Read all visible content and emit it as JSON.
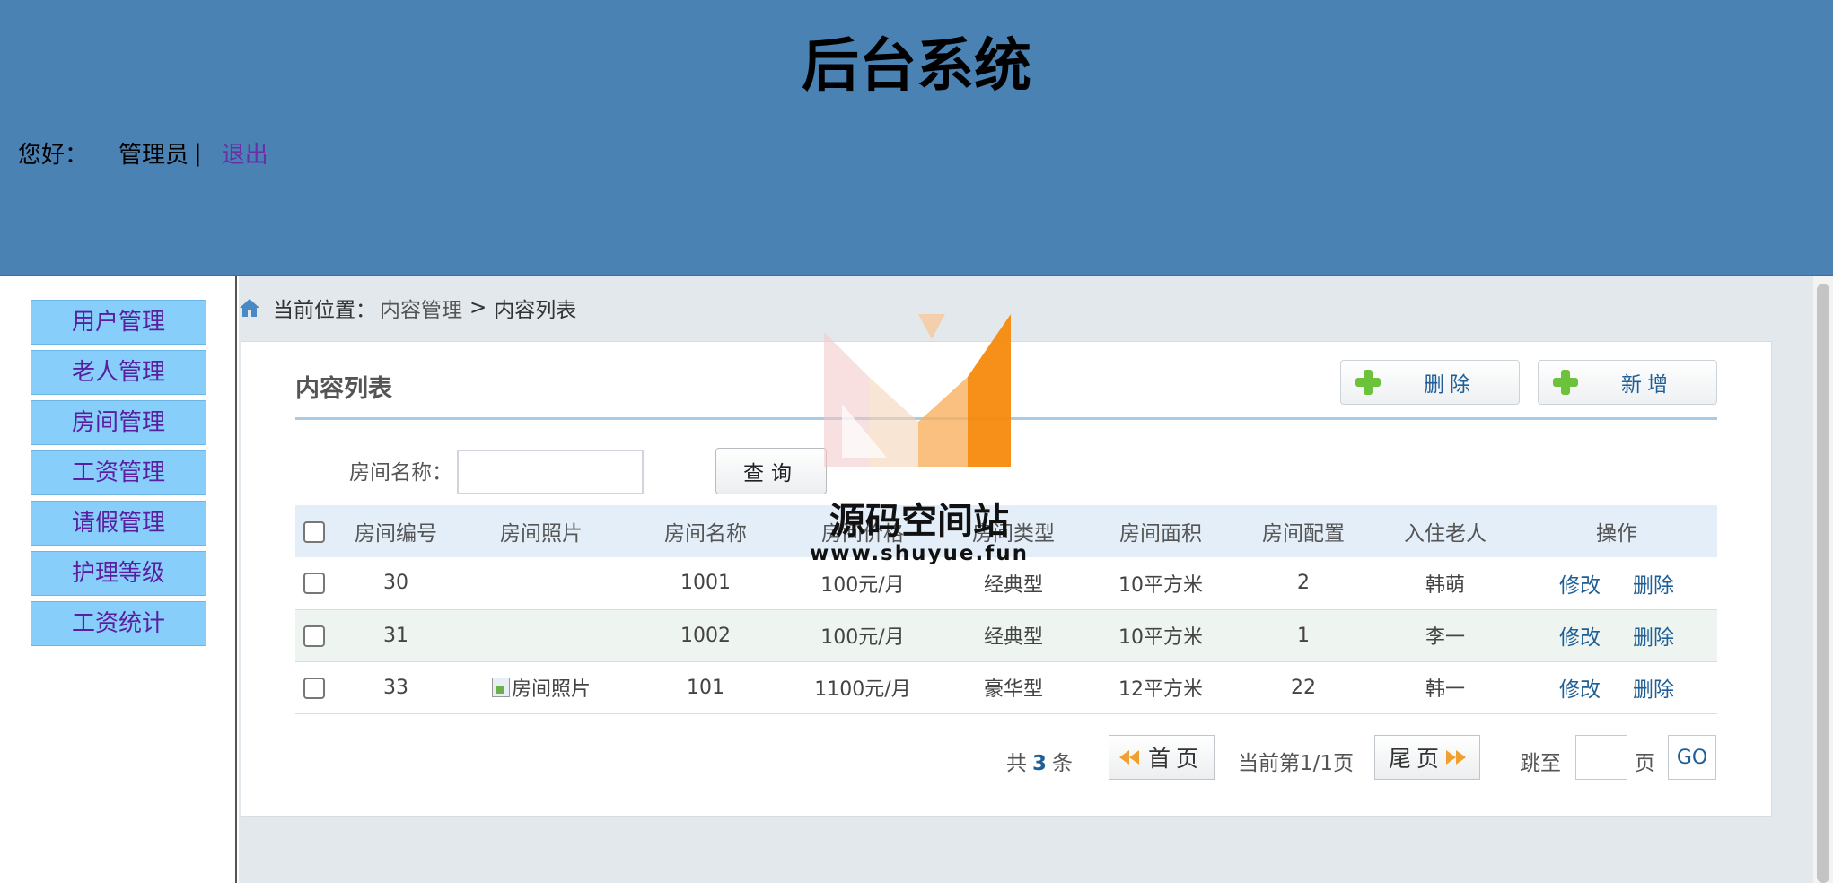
{
  "header": {
    "title": "后台系统",
    "greeting": "您好：",
    "user": "管理员",
    "separator": "|",
    "logout": "退出"
  },
  "sidebar": {
    "items": [
      {
        "label": "用户管理"
      },
      {
        "label": "老人管理"
      },
      {
        "label": "房间管理"
      },
      {
        "label": "工资管理"
      },
      {
        "label": "请假管理"
      },
      {
        "label": "护理等级"
      },
      {
        "label": "工资统计"
      }
    ]
  },
  "breadcrumb": {
    "current_label": "当前位置：",
    "path1": "内容管理",
    "arrow": ">",
    "path2": "内容列表"
  },
  "panel": {
    "title": "内容列表",
    "delete_label": "删除",
    "add_label": "新增"
  },
  "search": {
    "label": "房间名称：",
    "value": "",
    "button": "查询"
  },
  "table": {
    "headers": [
      "房间编号",
      "房间照片",
      "房间名称",
      "房间价格",
      "房间类型",
      "房间面积",
      "房间配置",
      "入住老人",
      "操作"
    ],
    "rows": [
      {
        "id": "30",
        "photo": "",
        "name": "1001",
        "price": "100元/月",
        "type": "经典型",
        "area": "10平方米",
        "config": "2",
        "elder": "韩萌"
      },
      {
        "id": "31",
        "photo": "",
        "name": "1002",
        "price": "100元/月",
        "type": "经典型",
        "area": "10平方米",
        "config": "1",
        "elder": "李一"
      },
      {
        "id": "33",
        "photo": "房间照片",
        "name": "101",
        "price": "1100元/月",
        "type": "豪华型",
        "area": "12平方米",
        "config": "22",
        "elder": "韩一"
      }
    ],
    "edit_label": "修改",
    "delete_label": "删除"
  },
  "pager": {
    "total_prefix": "共",
    "total_count": "3",
    "total_suffix": "条",
    "first_label": "首页",
    "page_info": "当前第1/1页",
    "last_label": "尾页",
    "jump_label": "跳至",
    "jump_value": "",
    "page_unit": "页",
    "go_label": "GO"
  },
  "watermark": {
    "text": "源码空间站",
    "url": "www.shuyue.fun"
  },
  "colors": {
    "header_bg": "#4a82b4",
    "menu_bg": "#87cefa",
    "menu_text": "#5a1fa0",
    "link": "#1f5f96",
    "plus_icon": "#6cc23b",
    "watermark_orange": "#f58a0c"
  }
}
